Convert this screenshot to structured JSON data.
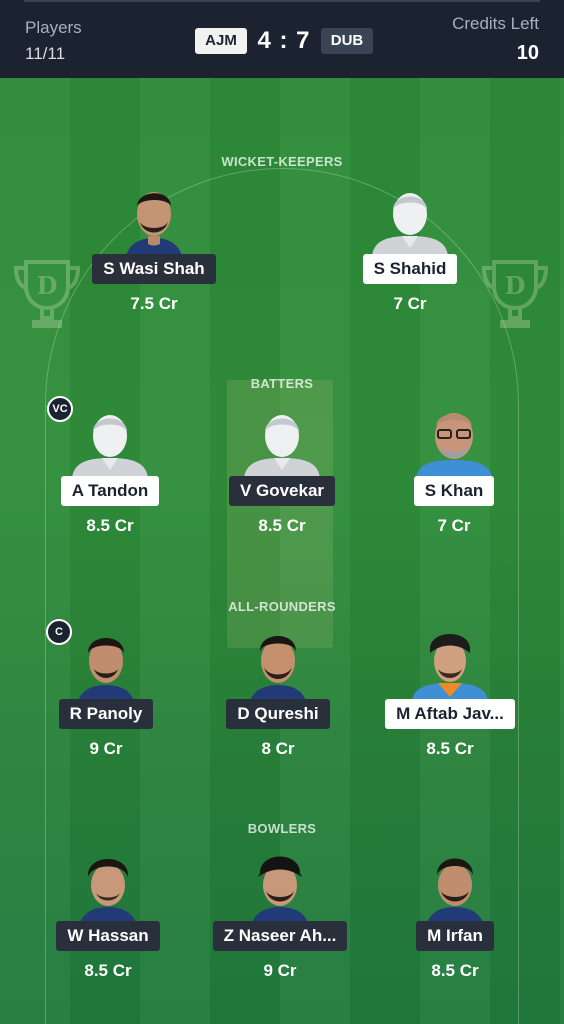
{
  "header": {
    "players_label": "Players",
    "players_value": "11/11",
    "team_a": "AJM",
    "score": "4 : 7",
    "team_b": "DUB",
    "credits_label": "Credits Left",
    "credits_value": "10"
  },
  "sections": {
    "wicket_keepers": "WICKET-KEEPERS",
    "batters": "BATTERS",
    "all_rounders": "ALL-ROUNDERS",
    "bowlers": "BOWLERS"
  },
  "badges": {
    "vice_captain": "VC",
    "captain": "C"
  },
  "players": {
    "wk": [
      {
        "name": "S Wasi Shah",
        "credits": "7.5 Cr",
        "team": "DUB",
        "avatar": "photo-avatar"
      },
      {
        "name": "S Shahid",
        "credits": "7 Cr",
        "team": "AJM",
        "avatar": "placeholder-avatar"
      }
    ],
    "bat": [
      {
        "name": "A Tandon",
        "credits": "8.5 Cr",
        "team": "AJM",
        "avatar": "placeholder-avatar"
      },
      {
        "name": "V Govekar",
        "credits": "8.5 Cr",
        "team": "DUB",
        "avatar": "placeholder-avatar"
      },
      {
        "name": "S Khan",
        "credits": "7 Cr",
        "team": "AJM",
        "avatar": "photo-avatar"
      }
    ],
    "ar": [
      {
        "name": "R Panoly",
        "credits": "9 Cr",
        "team": "DUB",
        "avatar": "photo-avatar"
      },
      {
        "name": "D Qureshi",
        "credits": "8 Cr",
        "team": "DUB",
        "avatar": "photo-avatar"
      },
      {
        "name": "M Aftab Jav...",
        "credits": "8.5 Cr",
        "team": "AJM",
        "avatar": "photo-avatar"
      }
    ],
    "bowl": [
      {
        "name": "W Hassan",
        "credits": "8.5 Cr",
        "team": "DUB",
        "avatar": "photo-avatar"
      },
      {
        "name": "Z Naseer Ah...",
        "credits": "9 Cr",
        "team": "DUB",
        "avatar": "photo-avatar"
      },
      {
        "name": "M Irfan",
        "credits": "8.5 Cr",
        "team": "DUB",
        "avatar": "photo-avatar"
      }
    ]
  },
  "colors": {
    "header_bg": "#1c2330",
    "field_green": "#2f8a3c",
    "team_dub_label_bg": "#2a2f3c",
    "team_ajm_label_bg": "#ffffff"
  }
}
